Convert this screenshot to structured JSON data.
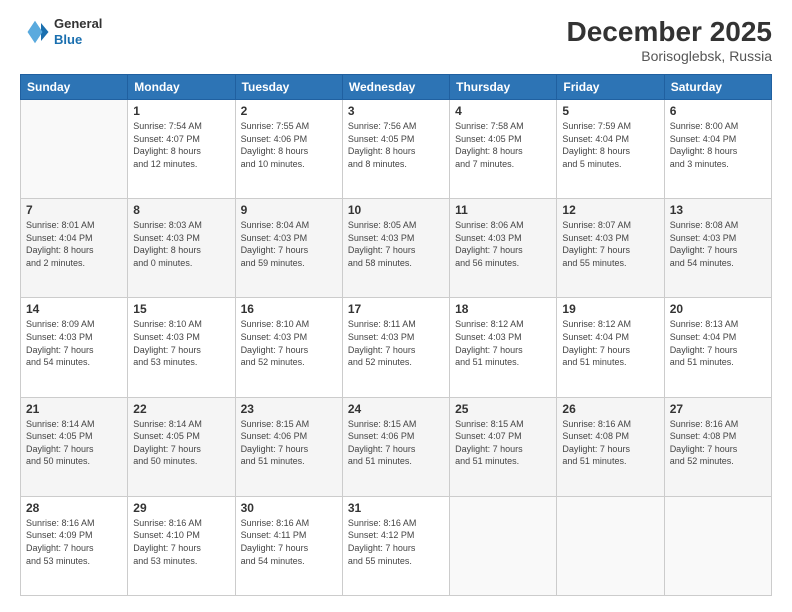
{
  "header": {
    "logo_general": "General",
    "logo_blue": "Blue",
    "month_title": "December 2025",
    "location": "Borisoglebsk, Russia"
  },
  "weekdays": [
    "Sunday",
    "Monday",
    "Tuesday",
    "Wednesday",
    "Thursday",
    "Friday",
    "Saturday"
  ],
  "weeks": [
    [
      {
        "day": "",
        "info": ""
      },
      {
        "day": "1",
        "info": "Sunrise: 7:54 AM\nSunset: 4:07 PM\nDaylight: 8 hours\nand 12 minutes."
      },
      {
        "day": "2",
        "info": "Sunrise: 7:55 AM\nSunset: 4:06 PM\nDaylight: 8 hours\nand 10 minutes."
      },
      {
        "day": "3",
        "info": "Sunrise: 7:56 AM\nSunset: 4:05 PM\nDaylight: 8 hours\nand 8 minutes."
      },
      {
        "day": "4",
        "info": "Sunrise: 7:58 AM\nSunset: 4:05 PM\nDaylight: 8 hours\nand 7 minutes."
      },
      {
        "day": "5",
        "info": "Sunrise: 7:59 AM\nSunset: 4:04 PM\nDaylight: 8 hours\nand 5 minutes."
      },
      {
        "day": "6",
        "info": "Sunrise: 8:00 AM\nSunset: 4:04 PM\nDaylight: 8 hours\nand 3 minutes."
      }
    ],
    [
      {
        "day": "7",
        "info": "Sunrise: 8:01 AM\nSunset: 4:04 PM\nDaylight: 8 hours\nand 2 minutes."
      },
      {
        "day": "8",
        "info": "Sunrise: 8:03 AM\nSunset: 4:03 PM\nDaylight: 8 hours\nand 0 minutes."
      },
      {
        "day": "9",
        "info": "Sunrise: 8:04 AM\nSunset: 4:03 PM\nDaylight: 7 hours\nand 59 minutes."
      },
      {
        "day": "10",
        "info": "Sunrise: 8:05 AM\nSunset: 4:03 PM\nDaylight: 7 hours\nand 58 minutes."
      },
      {
        "day": "11",
        "info": "Sunrise: 8:06 AM\nSunset: 4:03 PM\nDaylight: 7 hours\nand 56 minutes."
      },
      {
        "day": "12",
        "info": "Sunrise: 8:07 AM\nSunset: 4:03 PM\nDaylight: 7 hours\nand 55 minutes."
      },
      {
        "day": "13",
        "info": "Sunrise: 8:08 AM\nSunset: 4:03 PM\nDaylight: 7 hours\nand 54 minutes."
      }
    ],
    [
      {
        "day": "14",
        "info": "Sunrise: 8:09 AM\nSunset: 4:03 PM\nDaylight: 7 hours\nand 54 minutes."
      },
      {
        "day": "15",
        "info": "Sunrise: 8:10 AM\nSunset: 4:03 PM\nDaylight: 7 hours\nand 53 minutes."
      },
      {
        "day": "16",
        "info": "Sunrise: 8:10 AM\nSunset: 4:03 PM\nDaylight: 7 hours\nand 52 minutes."
      },
      {
        "day": "17",
        "info": "Sunrise: 8:11 AM\nSunset: 4:03 PM\nDaylight: 7 hours\nand 52 minutes."
      },
      {
        "day": "18",
        "info": "Sunrise: 8:12 AM\nSunset: 4:03 PM\nDaylight: 7 hours\nand 51 minutes."
      },
      {
        "day": "19",
        "info": "Sunrise: 8:12 AM\nSunset: 4:04 PM\nDaylight: 7 hours\nand 51 minutes."
      },
      {
        "day": "20",
        "info": "Sunrise: 8:13 AM\nSunset: 4:04 PM\nDaylight: 7 hours\nand 51 minutes."
      }
    ],
    [
      {
        "day": "21",
        "info": "Sunrise: 8:14 AM\nSunset: 4:05 PM\nDaylight: 7 hours\nand 50 minutes."
      },
      {
        "day": "22",
        "info": "Sunrise: 8:14 AM\nSunset: 4:05 PM\nDaylight: 7 hours\nand 50 minutes."
      },
      {
        "day": "23",
        "info": "Sunrise: 8:15 AM\nSunset: 4:06 PM\nDaylight: 7 hours\nand 51 minutes."
      },
      {
        "day": "24",
        "info": "Sunrise: 8:15 AM\nSunset: 4:06 PM\nDaylight: 7 hours\nand 51 minutes."
      },
      {
        "day": "25",
        "info": "Sunrise: 8:15 AM\nSunset: 4:07 PM\nDaylight: 7 hours\nand 51 minutes."
      },
      {
        "day": "26",
        "info": "Sunrise: 8:16 AM\nSunset: 4:08 PM\nDaylight: 7 hours\nand 51 minutes."
      },
      {
        "day": "27",
        "info": "Sunrise: 8:16 AM\nSunset: 4:08 PM\nDaylight: 7 hours\nand 52 minutes."
      }
    ],
    [
      {
        "day": "28",
        "info": "Sunrise: 8:16 AM\nSunset: 4:09 PM\nDaylight: 7 hours\nand 53 minutes."
      },
      {
        "day": "29",
        "info": "Sunrise: 8:16 AM\nSunset: 4:10 PM\nDaylight: 7 hours\nand 53 minutes."
      },
      {
        "day": "30",
        "info": "Sunrise: 8:16 AM\nSunset: 4:11 PM\nDaylight: 7 hours\nand 54 minutes."
      },
      {
        "day": "31",
        "info": "Sunrise: 8:16 AM\nSunset: 4:12 PM\nDaylight: 7 hours\nand 55 minutes."
      },
      {
        "day": "",
        "info": ""
      },
      {
        "day": "",
        "info": ""
      },
      {
        "day": "",
        "info": ""
      }
    ]
  ]
}
